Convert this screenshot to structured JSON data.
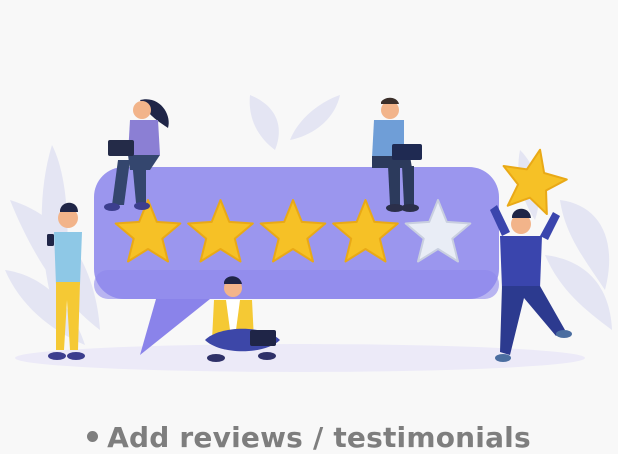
{
  "caption": {
    "text": "Add reviews / testimonials"
  },
  "rating": {
    "filled": 4,
    "total": 5
  },
  "colors": {
    "background": "#f8f8f8",
    "bubble": "#9b96ee",
    "bubble_shadow": "#7c74e6",
    "star_fill": "#f6c126",
    "star_empty": "#e9edf6",
    "caption": "#7e7e7e",
    "leaves": "#e4e5f3"
  },
  "icons": [
    "star-icon",
    "bullet-dot-icon",
    "laptop-icon",
    "phone-icon"
  ]
}
